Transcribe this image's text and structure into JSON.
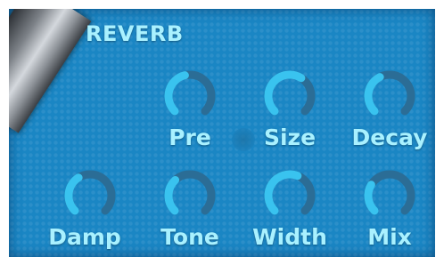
{
  "section": {
    "title": "REVERB"
  },
  "colors": {
    "background": "#1a86c4",
    "text": "#a9f1ff",
    "ring_track": "#2b6d96",
    "ring_value": "#39c3ef"
  },
  "knobs": [
    {
      "label": "Pre",
      "value": 0.45
    },
    {
      "label": "Size",
      "value": 0.62
    },
    {
      "label": "Decay",
      "value": 0.4
    },
    {
      "label": "Damp",
      "value": 0.38
    },
    {
      "label": "Tone",
      "value": 0.34
    },
    {
      "label": "Width",
      "value": 0.58
    },
    {
      "label": "Mix",
      "value": 0.28
    }
  ]
}
